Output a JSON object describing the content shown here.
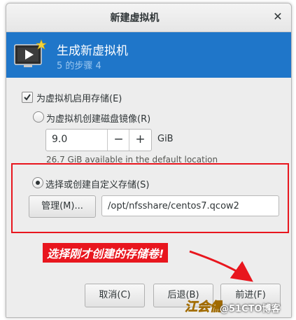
{
  "window": {
    "title": "新建虚拟机",
    "close_glyph": "✕"
  },
  "banner": {
    "title": "生成新虚拟机",
    "step": "5 的步骤 4",
    "icon": "monitor-play-icon",
    "bg_color": "#1f76c9"
  },
  "storage": {
    "enable_label": "为虚拟机启用存储(E)",
    "enable_checked": true,
    "create_disk_label": "为虚拟机创建磁盘镜像(R)",
    "create_disk_selected": false,
    "disk_size": "9.0",
    "minus_label": "−",
    "plus_label": "+",
    "unit": "GiB",
    "available_text": "26.7 GiB available in the default location",
    "custom_label": "选择或创建自定义存储(S)",
    "custom_selected": true,
    "manage_label": "管理(M)...",
    "path_value": "/opt/nfsshare/centos7.qcow2"
  },
  "annotation": {
    "text": "选择刚才创建的存储卷!",
    "color": "#e8161e"
  },
  "buttons": {
    "cancel": "取消(C)",
    "back": "后退(B)",
    "forward": "前进(F)"
  },
  "watermark": {
    "text": "@51CTO博客",
    "logo": "江会儒"
  }
}
